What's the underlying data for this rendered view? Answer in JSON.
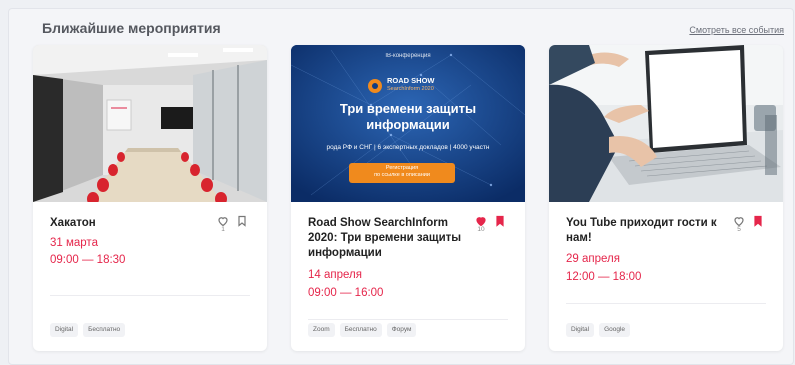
{
  "section": {
    "title": "Ближайшие мероприятия",
    "view_all": "Смотреть все события"
  },
  "colors": {
    "accent": "#e5264b",
    "banner_bg": "#0f3c82",
    "banner_button": "#f08a1d"
  },
  "icons": [
    "heart-icon",
    "bookmark-icon"
  ],
  "events": [
    {
      "title": "Хакатон",
      "date": "31 марта",
      "time": "09:00 — 18:30",
      "likes": "1",
      "liked": false,
      "saved": false,
      "tags": [
        "Digital",
        "Бесплатно"
      ]
    },
    {
      "title": "Road Show SearchInform 2020: Три времени защиты информации",
      "date": "14 апреля",
      "time": "09:00 — 16:00",
      "likes": "10",
      "liked": true,
      "saved": true,
      "tags": [
        "Zoom",
        "Бесплатно",
        "Форум"
      ],
      "banner": {
        "kicker": "IB-конференция",
        "brand_line1": "ROAD SHOW",
        "brand_line2": "SearchInform 2020",
        "headline_line1": "Три времени защиты",
        "headline_line2": "информации",
        "sub": "рода РФ и СНГ | 6 экспертных докладов | 4000 участн",
        "cta_line1": "Регистрация",
        "cta_line2": "по ссылке в описании"
      }
    },
    {
      "title": "You Tube приходит гости к нам!",
      "date": "29 апреля",
      "time": "12:00 — 18:00",
      "likes": "5",
      "liked": false,
      "saved": true,
      "tags": [
        "Digital",
        "Google"
      ]
    }
  ]
}
